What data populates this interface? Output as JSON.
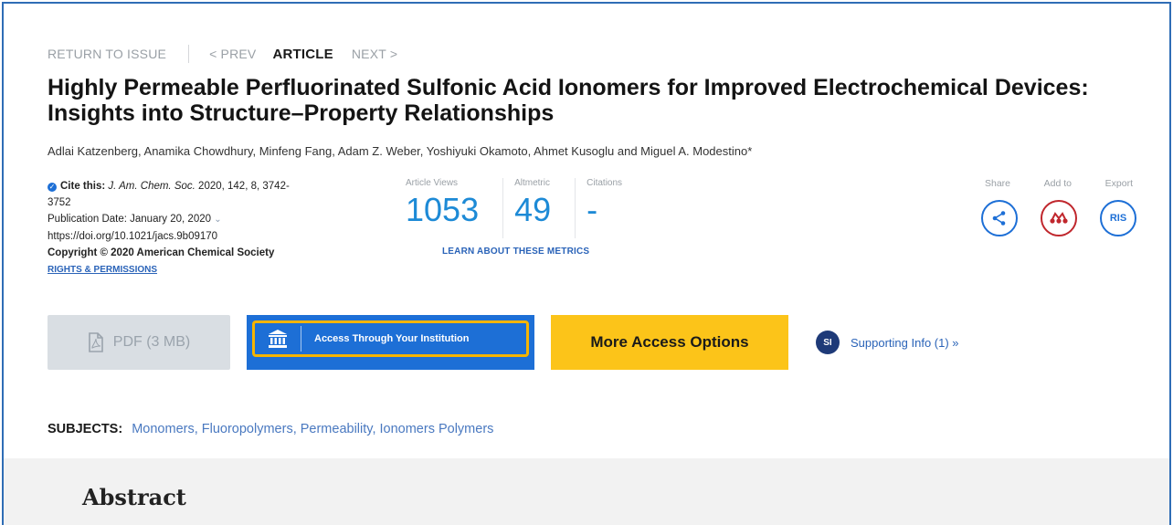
{
  "nav": {
    "return_to_issue": "RETURN TO ISSUE",
    "prev": "< PREV",
    "current": "ARTICLE",
    "next": "NEXT >"
  },
  "article": {
    "title": "Highly Permeable Perfluorinated Sulfonic Acid Ionomers for Improved Electrochemical Devices: Insights into Structure–Property Relationships",
    "authors": "Adlai Katzenberg, Anamika Chowdhury, Minfeng Fang, Adam Z. Weber, Yoshiyuki Okamoto, Ahmet Kusoglu and Miguel A. Modestino*"
  },
  "citation": {
    "cite_label": "Cite this:",
    "journal": "J. Am. Chem. Soc.",
    "details": "2020, 142, 8, 3742-",
    "pages_cont": "3752",
    "pub_date": "Publication Date: January 20, 2020",
    "doi": "https://doi.org/10.1021/jacs.9b09170",
    "copyright": "Copyright © 2020 American Chemical Society",
    "rights": "RIGHTS & PERMISSIONS"
  },
  "metrics": {
    "items": [
      {
        "label": "Article Views",
        "value": "1053"
      },
      {
        "label": "Altmetric",
        "value": "49"
      },
      {
        "label": "Citations",
        "value": "-"
      }
    ],
    "learn_more": "LEARN ABOUT THESE METRICS"
  },
  "actions": {
    "share": "Share",
    "add_to": "Add to",
    "export": "Export",
    "ris": "RIS"
  },
  "buttons": {
    "pdf": "PDF (3 MB)",
    "institution": "Access Through Your Institution",
    "more_access": "More Access Options"
  },
  "supporting": {
    "badge": "SI",
    "label": "Supporting Info (1) »"
  },
  "subjects": {
    "label": "SUBJECTS:",
    "values": "Monomers, Fluoropolymers, Permeability, Ionomers Polymers"
  },
  "abstract": {
    "heading": "Abstract"
  },
  "colors": {
    "accent_blue": "#1d6fd6",
    "highlight_border": "#f5b400",
    "more_access_yellow": "#fcc419",
    "addto_red": "#c0272d"
  }
}
